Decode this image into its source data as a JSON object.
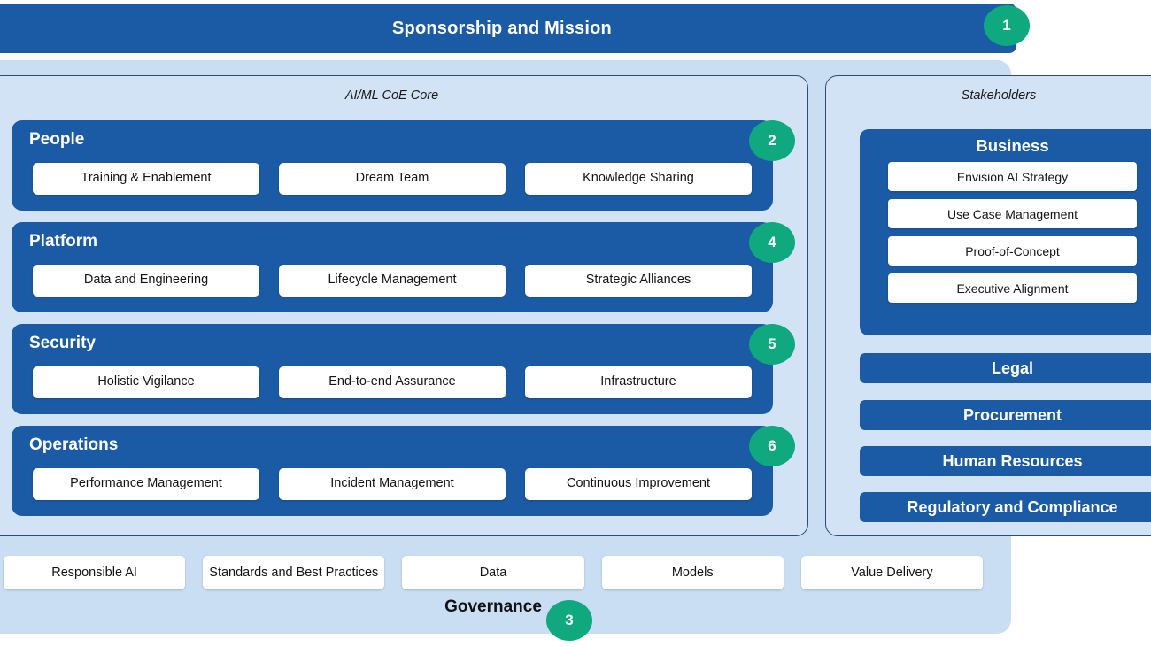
{
  "banner": {
    "title": "Sponsorship and Mission",
    "badge": "1"
  },
  "core": {
    "caption": "AI/ML CoE Core",
    "pillars": [
      {
        "title": "People",
        "badge": "2",
        "items": [
          "Training & Enablement",
          "Dream Team",
          "Knowledge Sharing"
        ]
      },
      {
        "title": "Platform",
        "badge": "4",
        "items": [
          "Data and Engineering",
          "Lifecycle Management",
          "Strategic Alliances"
        ]
      },
      {
        "title": "Security",
        "badge": "5",
        "items": [
          "Holistic Vigilance",
          "End-to-end Assurance",
          "Infrastructure"
        ]
      },
      {
        "title": "Operations",
        "badge": "6",
        "items": [
          "Performance Management",
          "Incident Management",
          "Continuous Improvement"
        ]
      }
    ]
  },
  "stakeholders": {
    "caption": "Stakeholders",
    "business": {
      "title": "Business",
      "items": [
        "Envision AI Strategy",
        "Use Case Management",
        "Proof-of-Concept",
        "Executive Alignment"
      ]
    },
    "bars": [
      "Legal",
      "Procurement",
      "Human Resources",
      "Regulatory and Compliance"
    ]
  },
  "governance": {
    "label": "Governance",
    "badge": "3",
    "items": [
      "Responsible AI",
      "Standards and Best Practices",
      "Data",
      "Models",
      "Value Delivery"
    ]
  },
  "colors": {
    "primary_blue": "#1B5AA4",
    "panel_blue": "#D3E3F6",
    "outer_blue": "#C9DDF3",
    "badge_green": "#0FA87F",
    "panel_border": "#2C4C74",
    "chip_white": "#FFFFFF"
  }
}
